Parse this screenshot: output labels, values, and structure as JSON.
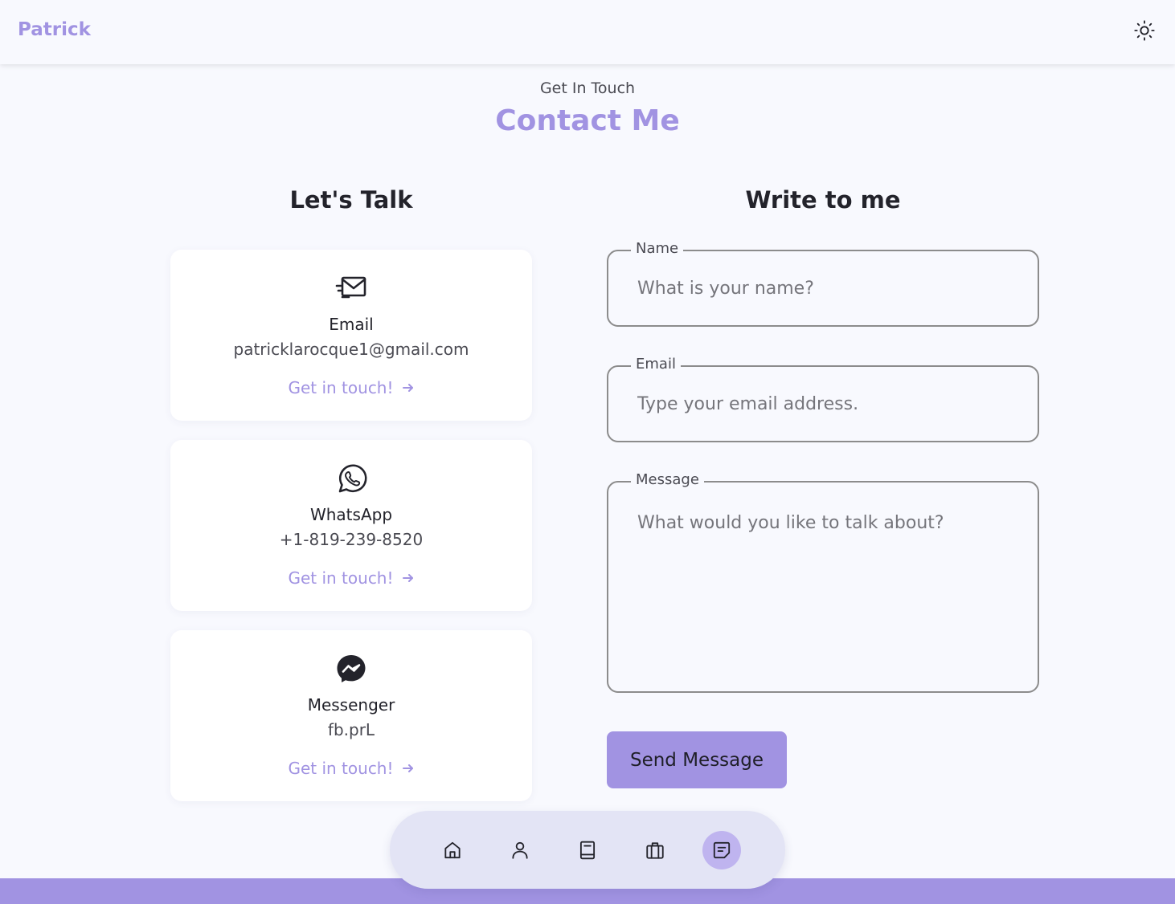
{
  "header": {
    "logo": "Patrick",
    "theme_toggle_icon": "sun-icon"
  },
  "section": {
    "subtitle": "Get In Touch",
    "title": "Contact Me"
  },
  "contact": {
    "heading": "Let's Talk",
    "cards": [
      {
        "icon": "email-icon",
        "title": "Email",
        "data": "patricklarocque1@gmail.com",
        "link": "Get in touch!"
      },
      {
        "icon": "whatsapp-icon",
        "title": "WhatsApp",
        "data": "+1-819-239-8520",
        "link": "Get in touch!"
      },
      {
        "icon": "messenger-icon",
        "title": "Messenger",
        "data": "fb.prL",
        "link": "Get in touch!"
      }
    ]
  },
  "form": {
    "heading": "Write to me",
    "name": {
      "label": "Name",
      "placeholder": "What is your name?"
    },
    "email": {
      "label": "Email",
      "placeholder": "Type your email address."
    },
    "message": {
      "label": "Message",
      "placeholder": "What would you like to talk about?"
    },
    "submit": "Send Message"
  },
  "nav": {
    "items": [
      "home-icon",
      "user-icon",
      "book-icon",
      "briefcase-icon",
      "message-icon"
    ],
    "active": "message-icon"
  },
  "colors": {
    "accent": "#a193e2",
    "background": "#f8f9fe",
    "card": "#ffffff",
    "text": "#23232b"
  }
}
